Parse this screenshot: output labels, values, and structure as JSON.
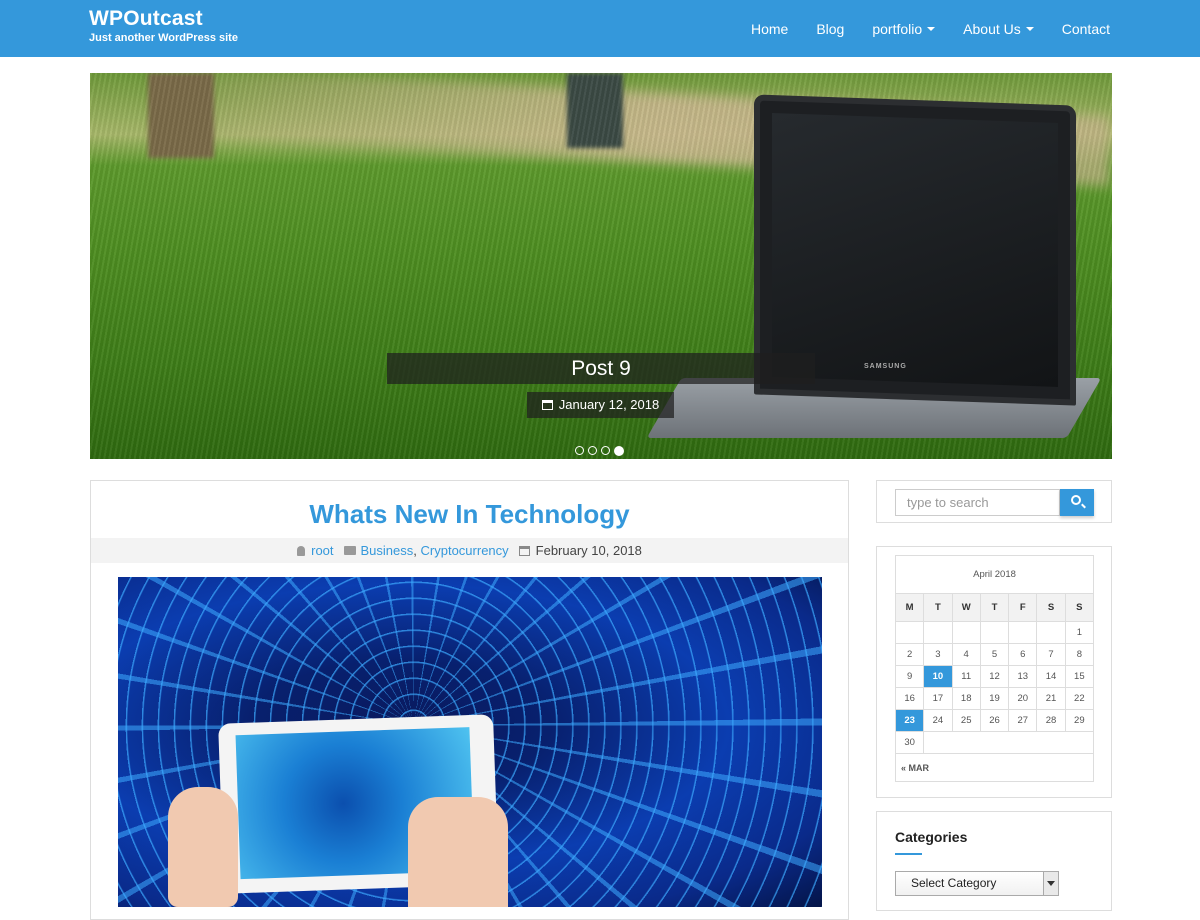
{
  "site": {
    "title": "WPOutcast",
    "tagline": "Just another WordPress site"
  },
  "nav": {
    "items": [
      {
        "label": "Home"
      },
      {
        "label": "Blog"
      },
      {
        "label": "portfolio"
      },
      {
        "label": "About Us"
      },
      {
        "label": "Contact"
      }
    ]
  },
  "slider": {
    "caption": "Post 9",
    "date": "January 12, 2018",
    "laptop_brand": "SAMSUNG",
    "dots_total": 4,
    "active_dot": 4
  },
  "post": {
    "title": "Whats New In Technology",
    "author": "root",
    "categories": [
      "Business",
      "Cryptocurrency"
    ],
    "category_separator": ",",
    "date": "February 10, 2018"
  },
  "search": {
    "placeholder": "type to search"
  },
  "calendar": {
    "caption": "April 2018",
    "weekdays": [
      "M",
      "T",
      "W",
      "T",
      "F",
      "S",
      "S"
    ],
    "rows": [
      [
        "",
        "",
        "",
        "",
        "",
        "",
        "1"
      ],
      [
        "2",
        "3",
        "4",
        "5",
        "6",
        "7",
        "8"
      ],
      [
        "9",
        "10",
        "11",
        "12",
        "13",
        "14",
        "15"
      ],
      [
        "16",
        "17",
        "18",
        "19",
        "20",
        "21",
        "22"
      ],
      [
        "23",
        "24",
        "25",
        "26",
        "27",
        "28",
        "29"
      ],
      [
        "30"
      ]
    ],
    "highlighted": [
      "10",
      "23"
    ],
    "prev_link": "« MAR"
  },
  "categories": {
    "title": "Categories",
    "selected": "Select Category"
  },
  "colors": {
    "accent": "#3498db",
    "header_bg": "#3498db"
  }
}
